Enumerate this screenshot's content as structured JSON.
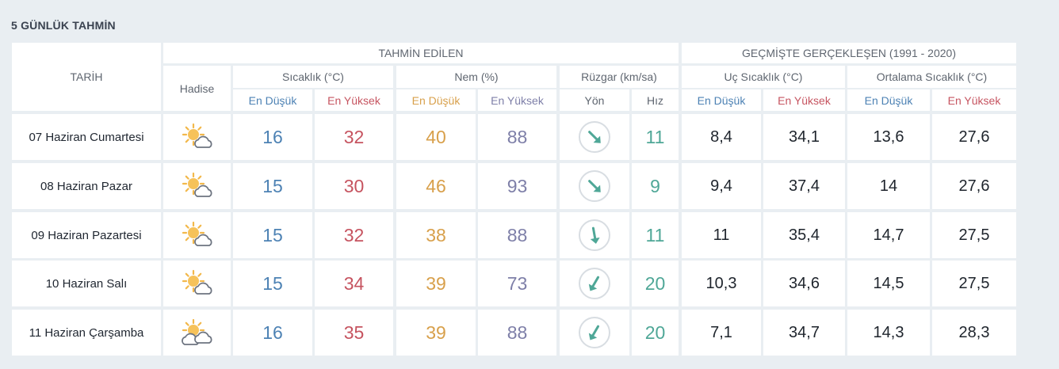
{
  "page_title": "5 GÜNLÜK TAHMİN",
  "header": {
    "tarih": "TARİH",
    "tahmin_edilen": "TAHMİN EDİLEN",
    "gecmiste": "GEÇMİŞTE GERÇEKLEŞEN (1991 - 2020)",
    "hadise": "Hadise",
    "sicaklik": "Sıcaklık (°C)",
    "nem": "Nem (%)",
    "ruzgar": "Rüzgar (km/sa)",
    "uc_sicaklik": "Uç Sıcaklık (°C)",
    "ortalama_sicaklik": "Ortalama Sıcaklık (°C)",
    "en_dusuk": "En Düşük",
    "en_yuksek": "En Yüksek",
    "yon": "Yön",
    "hiz": "Hız"
  },
  "colors": {
    "low": "#4d82b4",
    "high": "#c65460",
    "humidity_low": "#d8a04b",
    "humidity_high": "#7e7fa8",
    "wind": "#4fa797"
  },
  "rows": [
    {
      "date": "07 Haziran Cumartesi",
      "icon": "partly-cloudy-icon",
      "temp_low": "16",
      "temp_high": "32",
      "hum_low": "40",
      "hum_high": "88",
      "wind_dir_deg": 135,
      "wind_speed": "11",
      "ext_low": "8,4",
      "ext_high": "34,1",
      "avg_low": "13,6",
      "avg_high": "27,6"
    },
    {
      "date": "08 Haziran Pazar",
      "icon": "partly-cloudy-icon",
      "temp_low": "15",
      "temp_high": "30",
      "hum_low": "46",
      "hum_high": "93",
      "wind_dir_deg": 135,
      "wind_speed": "9",
      "ext_low": "9,4",
      "ext_high": "37,4",
      "avg_low": "14",
      "avg_high": "27,6"
    },
    {
      "date": "09 Haziran Pazartesi",
      "icon": "partly-cloudy-icon",
      "temp_low": "15",
      "temp_high": "32",
      "hum_low": "38",
      "hum_high": "88",
      "wind_dir_deg": 170,
      "wind_speed": "11",
      "ext_low": "11",
      "ext_high": "35,4",
      "avg_low": "14,7",
      "avg_high": "27,5"
    },
    {
      "date": "10 Haziran Salı",
      "icon": "partly-cloudy-icon",
      "temp_low": "15",
      "temp_high": "34",
      "hum_low": "39",
      "hum_high": "73",
      "wind_dir_deg": 210,
      "wind_speed": "20",
      "ext_low": "10,3",
      "ext_high": "34,6",
      "avg_low": "14,5",
      "avg_high": "27,5"
    },
    {
      "date": "11 Haziran Çarşamba",
      "icon": "partly-cloudy-two-clouds-icon",
      "temp_low": "16",
      "temp_high": "35",
      "hum_low": "39",
      "hum_high": "88",
      "wind_dir_deg": 210,
      "wind_speed": "20",
      "ext_low": "7,1",
      "ext_high": "34,7",
      "avg_low": "14,3",
      "avg_high": "28,3"
    }
  ]
}
